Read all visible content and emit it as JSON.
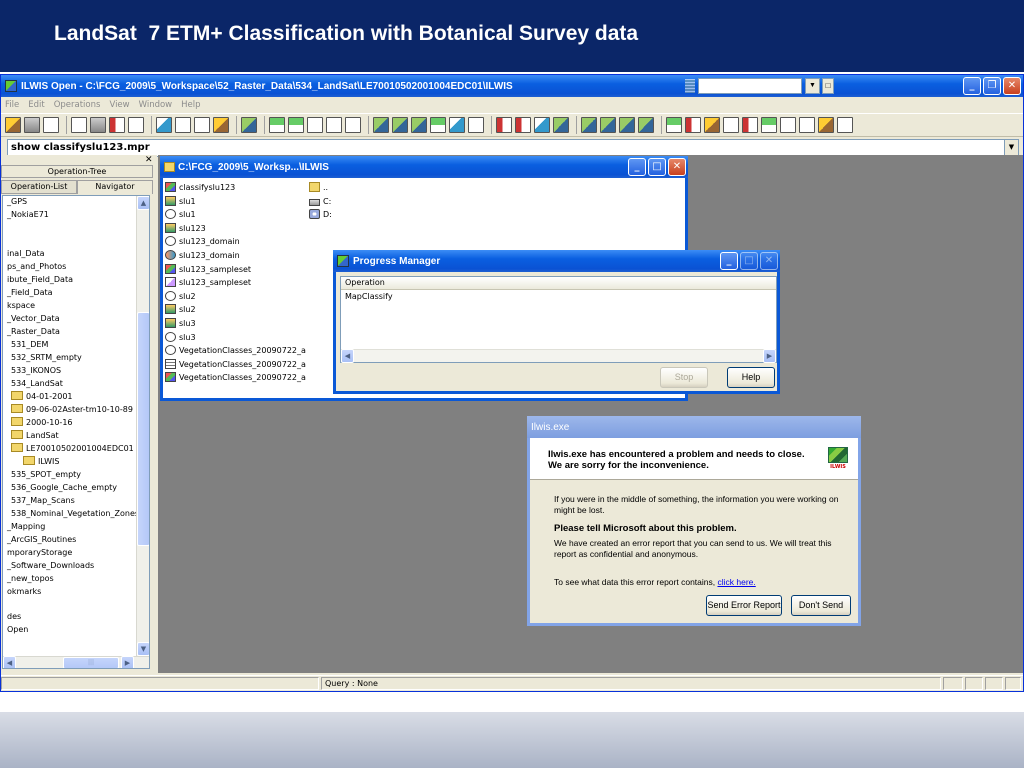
{
  "slide": {
    "title": "LandSat  7 ETM+ Classification with Botanical Survey data"
  },
  "main_window": {
    "title": "ILWIS Open - C:\\FCG_2009\\5_Workspace\\52_Raster_Data\\534_LandSat\\LE70010502001004EDC01\\ILWIS",
    "menu": [
      "File",
      "Edit",
      "Operations",
      "View",
      "Window",
      "Help"
    ],
    "command_line": "show classifyslu123.mpr",
    "status_text": "Query : None"
  },
  "navigator": {
    "operation_tree_label": "Operation-Tree",
    "tabs": [
      "Operation-List",
      "Navigator"
    ],
    "tree_items": [
      {
        "label": "_GPS",
        "indent": 4,
        "folder": false
      },
      {
        "label": "_NokiaE71",
        "indent": 4,
        "folder": false
      },
      {
        "label": "inal_Data",
        "indent": 4,
        "folder": false
      },
      {
        "label": "ps_and_Photos",
        "indent": 4,
        "folder": false
      },
      {
        "label": "ibute_Field_Data",
        "indent": 4,
        "folder": false
      },
      {
        "label": "_Field_Data",
        "indent": 4,
        "folder": false
      },
      {
        "label": "kspace",
        "indent": 4,
        "folder": false
      },
      {
        "label": "_Vector_Data",
        "indent": 4,
        "folder": false
      },
      {
        "label": "_Raster_Data",
        "indent": 4,
        "folder": false
      },
      {
        "label": "531_DEM",
        "indent": 8,
        "folder": false
      },
      {
        "label": "532_SRTM_empty",
        "indent": 8,
        "folder": false
      },
      {
        "label": "533_IKONOS",
        "indent": 8,
        "folder": false
      },
      {
        "label": "534_LandSat",
        "indent": 8,
        "folder": false
      },
      {
        "label": "04-01-2001",
        "indent": 8,
        "folder": true
      },
      {
        "label": "09-06-02Aster-tm10-10-89",
        "indent": 8,
        "folder": true
      },
      {
        "label": "2000-10-16",
        "indent": 8,
        "folder": true
      },
      {
        "label": "LandSat",
        "indent": 8,
        "folder": true
      },
      {
        "label": "LE70010502001004EDC01",
        "indent": 8,
        "folder": true
      },
      {
        "label": "ILWIS",
        "indent": 20,
        "folder": true
      },
      {
        "label": "535_SPOT_empty",
        "indent": 8,
        "folder": false
      },
      {
        "label": "536_Google_Cache_empty",
        "indent": 8,
        "folder": false
      },
      {
        "label": "537_Map_Scans",
        "indent": 8,
        "folder": false
      },
      {
        "label": "538_Nominal_Vegetation_Zones",
        "indent": 8,
        "folder": false
      },
      {
        "label": "_Mapping",
        "indent": 4,
        "folder": false
      },
      {
        "label": "_ArcGIS_Routines",
        "indent": 4,
        "folder": false
      },
      {
        "label": "mporaryStorage",
        "indent": 4,
        "folder": false
      },
      {
        "label": "_Software_Downloads",
        "indent": 4,
        "folder": false
      },
      {
        "label": "_new_topos",
        "indent": 4,
        "folder": false
      },
      {
        "label": "okmarks",
        "indent": 4,
        "folder": false
      },
      {
        "label": "des",
        "indent": 4,
        "folder": false
      },
      {
        "label": "Open",
        "indent": 4,
        "folder": false
      }
    ]
  },
  "catalog": {
    "title": "C:\\FCG_2009\\5_Worksp...\\ILWIS",
    "items": [
      {
        "label": "classifyslu123",
        "icon": "map"
      },
      {
        "label": "slu1",
        "icon": "raster"
      },
      {
        "label": "slu1",
        "icon": "domain"
      },
      {
        "label": "slu123",
        "icon": "raster"
      },
      {
        "label": "slu123_domain",
        "icon": "domain"
      },
      {
        "label": "slu123_domain",
        "icon": "repr"
      },
      {
        "label": "slu123_sampleset",
        "icon": "map"
      },
      {
        "label": "slu123_sampleset",
        "icon": "sample"
      },
      {
        "label": "slu2",
        "icon": "domain"
      },
      {
        "label": "slu2",
        "icon": "raster"
      },
      {
        "label": "slu3",
        "icon": "raster"
      },
      {
        "label": "slu3",
        "icon": "domain"
      },
      {
        "label": "VegetationClasses_20090722_a",
        "icon": "domain"
      },
      {
        "label": "VegetationClasses_20090722_a",
        "icon": "table"
      },
      {
        "label": "VegetationClasses_20090722_a",
        "icon": "map"
      }
    ],
    "drives": [
      {
        "label": "..",
        "icon": "folder"
      },
      {
        "label": "C:",
        "icon": "drive"
      },
      {
        "label": "D:",
        "icon": "cd"
      }
    ]
  },
  "progress_manager": {
    "title": "Progress Manager",
    "column_header": "Operation",
    "rows": [
      "MapClassify"
    ],
    "stop_label": "Stop",
    "help_label": "Help"
  },
  "error_dialog": {
    "title": "Ilwis.exe",
    "message_line1": "Ilwis.exe has encountered a problem and needs to close.",
    "message_line2": "We are sorry for the inconvenience.",
    "info_text": "If you were in the middle of something, the information you were working on might be lost.",
    "tell_heading": "Please tell Microsoft about this problem.",
    "report_text": "We have created an error report that you can send to us.  We will treat this report as confidential and anonymous.",
    "see_text": "To see what data this error report contains, ",
    "link_text": "click here.",
    "send_label": "Send Error Report",
    "dont_send_label": "Don't Send",
    "logo_text": "ILWIS"
  }
}
